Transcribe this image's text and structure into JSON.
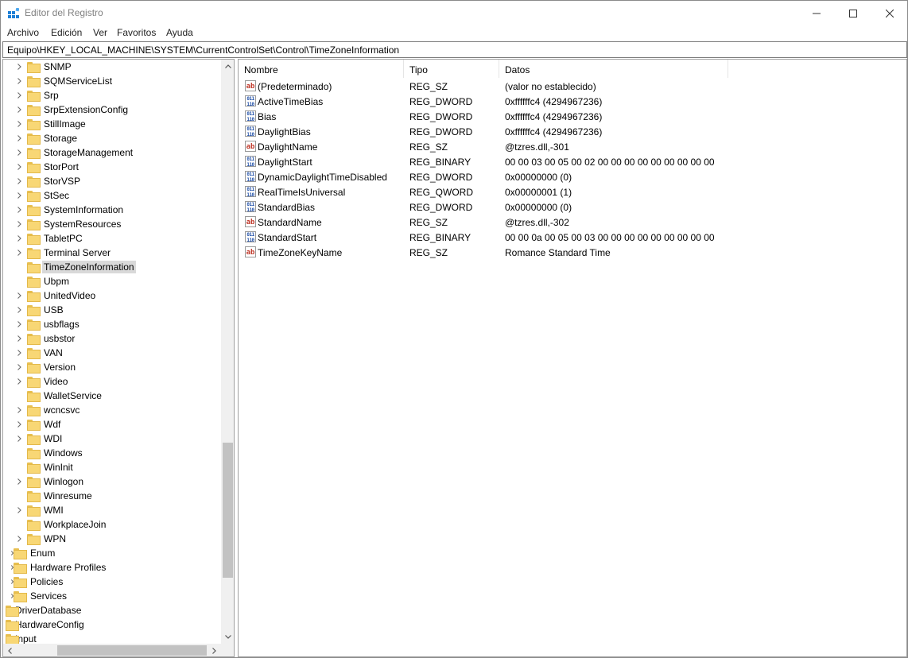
{
  "window": {
    "title": "Editor del Registro"
  },
  "menu": [
    "Archivo",
    "Edición",
    "Ver",
    "Favoritos",
    "Ayuda"
  ],
  "address": "Equipo\\HKEY_LOCAL_MACHINE\\SYSTEM\\CurrentControlSet\\Control\\TimeZoneInformation",
  "tree": [
    {
      "label": "SNMP",
      "level": 2,
      "expandable": true,
      "selected": false
    },
    {
      "label": "SQMServiceList",
      "level": 2,
      "expandable": true,
      "selected": false
    },
    {
      "label": "Srp",
      "level": 2,
      "expandable": true,
      "selected": false
    },
    {
      "label": "SrpExtensionConfig",
      "level": 2,
      "expandable": true,
      "selected": false
    },
    {
      "label": "StillImage",
      "level": 2,
      "expandable": true,
      "selected": false
    },
    {
      "label": "Storage",
      "level": 2,
      "expandable": true,
      "selected": false
    },
    {
      "label": "StorageManagement",
      "level": 2,
      "expandable": true,
      "selected": false
    },
    {
      "label": "StorPort",
      "level": 2,
      "expandable": true,
      "selected": false
    },
    {
      "label": "StorVSP",
      "level": 2,
      "expandable": true,
      "selected": false
    },
    {
      "label": "StSec",
      "level": 2,
      "expandable": true,
      "selected": false
    },
    {
      "label": "SystemInformation",
      "level": 2,
      "expandable": true,
      "selected": false
    },
    {
      "label": "SystemResources",
      "level": 2,
      "expandable": true,
      "selected": false
    },
    {
      "label": "TabletPC",
      "level": 2,
      "expandable": true,
      "selected": false
    },
    {
      "label": "Terminal Server",
      "level": 2,
      "expandable": true,
      "selected": false
    },
    {
      "label": "TimeZoneInformation",
      "level": 2,
      "expandable": false,
      "selected": true
    },
    {
      "label": "Ubpm",
      "level": 2,
      "expandable": false,
      "selected": false
    },
    {
      "label": "UnitedVideo",
      "level": 2,
      "expandable": true,
      "selected": false
    },
    {
      "label": "USB",
      "level": 2,
      "expandable": true,
      "selected": false
    },
    {
      "label": "usbflags",
      "level": 2,
      "expandable": true,
      "selected": false
    },
    {
      "label": "usbstor",
      "level": 2,
      "expandable": true,
      "selected": false
    },
    {
      "label": "VAN",
      "level": 2,
      "expandable": true,
      "selected": false
    },
    {
      "label": "Version",
      "level": 2,
      "expandable": true,
      "selected": false
    },
    {
      "label": "Video",
      "level": 2,
      "expandable": true,
      "selected": false
    },
    {
      "label": "WalletService",
      "level": 2,
      "expandable": false,
      "selected": false
    },
    {
      "label": "wcncsvc",
      "level": 2,
      "expandable": true,
      "selected": false
    },
    {
      "label": "Wdf",
      "level": 2,
      "expandable": true,
      "selected": false
    },
    {
      "label": "WDI",
      "level": 2,
      "expandable": true,
      "selected": false
    },
    {
      "label": "Windows",
      "level": 2,
      "expandable": false,
      "selected": false
    },
    {
      "label": "WinInit",
      "level": 2,
      "expandable": false,
      "selected": false
    },
    {
      "label": "Winlogon",
      "level": 2,
      "expandable": true,
      "selected": false
    },
    {
      "label": "Winresume",
      "level": 2,
      "expandable": false,
      "selected": false
    },
    {
      "label": "WMI",
      "level": 2,
      "expandable": true,
      "selected": false
    },
    {
      "label": "WorkplaceJoin",
      "level": 2,
      "expandable": false,
      "selected": false
    },
    {
      "label": "WPN",
      "level": 2,
      "expandable": true,
      "selected": false
    },
    {
      "label": "Enum",
      "level": 1,
      "expandable": true,
      "selected": false
    },
    {
      "label": "Hardware Profiles",
      "level": 1,
      "expandable": true,
      "selected": false
    },
    {
      "label": "Policies",
      "level": 1,
      "expandable": true,
      "selected": false
    },
    {
      "label": "Services",
      "level": 1,
      "expandable": true,
      "selected": false
    },
    {
      "label": "DriverDatabase",
      "level": 0,
      "expandable": true,
      "selected": false
    },
    {
      "label": "HardwareConfig",
      "level": 0,
      "expandable": true,
      "selected": false
    },
    {
      "label": "Input",
      "level": 0,
      "expandable": true,
      "selected": false
    }
  ],
  "columns": {
    "name": "Nombre",
    "type": "Tipo",
    "data": "Datos"
  },
  "values": [
    {
      "icon": "string-value-icon",
      "name": "(Predeterminado)",
      "type": "REG_SZ",
      "data": "(valor no establecido)"
    },
    {
      "icon": "binary-value-icon",
      "name": "ActiveTimeBias",
      "type": "REG_DWORD",
      "data": "0xffffffc4 (4294967236)"
    },
    {
      "icon": "binary-value-icon",
      "name": "Bias",
      "type": "REG_DWORD",
      "data": "0xffffffc4 (4294967236)"
    },
    {
      "icon": "binary-value-icon",
      "name": "DaylightBias",
      "type": "REG_DWORD",
      "data": "0xffffffc4 (4294967236)"
    },
    {
      "icon": "string-value-icon",
      "name": "DaylightName",
      "type": "REG_SZ",
      "data": "@tzres.dll,-301"
    },
    {
      "icon": "binary-value-icon",
      "name": "DaylightStart",
      "type": "REG_BINARY",
      "data": "00 00 03 00 05 00 02 00 00 00 00 00 00 00 00 00"
    },
    {
      "icon": "binary-value-icon",
      "name": "DynamicDaylightTimeDisabled",
      "type": "REG_DWORD",
      "data": "0x00000000 (0)"
    },
    {
      "icon": "binary-value-icon",
      "name": "RealTimeIsUniversal",
      "type": "REG_QWORD",
      "data": "0x00000001 (1)"
    },
    {
      "icon": "binary-value-icon",
      "name": "StandardBias",
      "type": "REG_DWORD",
      "data": "0x00000000 (0)"
    },
    {
      "icon": "string-value-icon",
      "name": "StandardName",
      "type": "REG_SZ",
      "data": "@tzres.dll,-302"
    },
    {
      "icon": "binary-value-icon",
      "name": "StandardStart",
      "type": "REG_BINARY",
      "data": "00 00 0a 00 05 00 03 00 00 00 00 00 00 00 00 00"
    },
    {
      "icon": "string-value-icon",
      "name": "TimeZoneKeyName",
      "type": "REG_SZ",
      "data": "Romance Standard Time"
    }
  ],
  "colors": {
    "selection": "#d9d9d9",
    "folder": "#f8d775",
    "string_icon": "#c0392b",
    "binary_icon": "#1f4fa8"
  }
}
